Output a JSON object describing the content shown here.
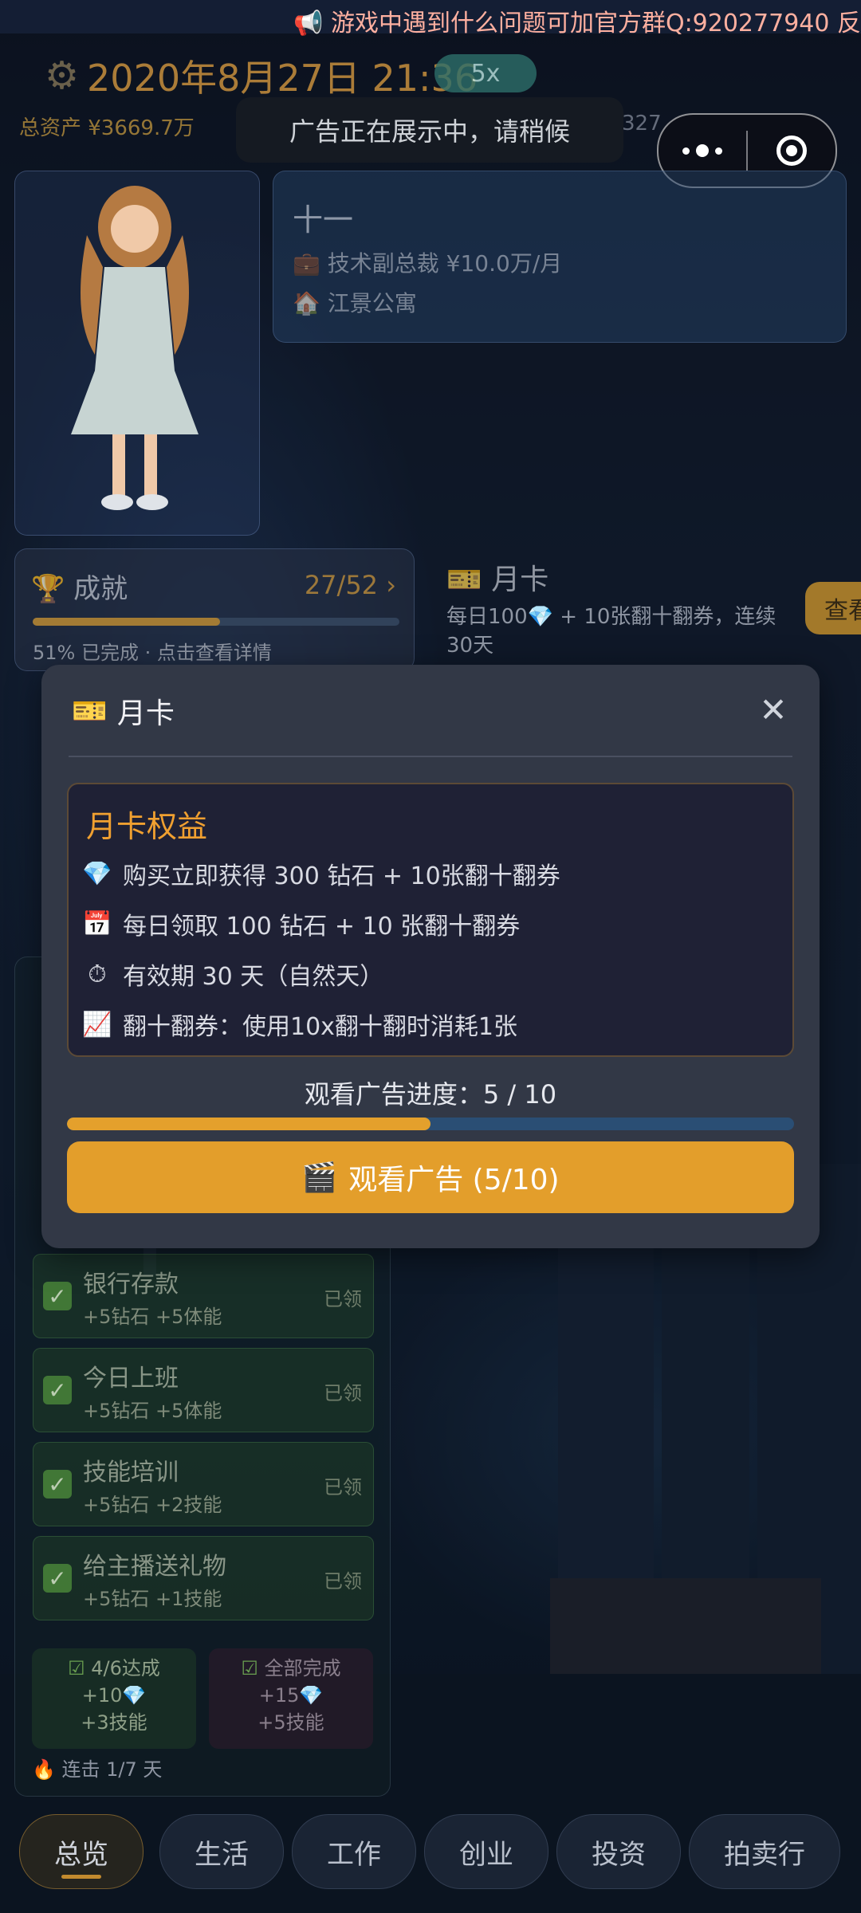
{
  "marquee": {
    "text": "📢 游戏中遇到什么问题可加官方群Q:920277940 反"
  },
  "header": {
    "datetime": "2020年8月27日 21:36",
    "speed": "5x",
    "assets": "总资产 ¥3669.7万",
    "assets_right_partial": "327"
  },
  "toast": "广告正在展示中，请稍候",
  "profile": {
    "name": "十一",
    "job": "技术副总裁 ¥10.0万/月",
    "home": "江景公寓"
  },
  "achievement": {
    "title": "成就",
    "count": "27/52",
    "progress": 0.51,
    "subtitle": "51% 已完成 · 点击查看详情"
  },
  "month_card_tile": {
    "title": "月卡",
    "desc": "每日100💎 + 10张翻十翻券，连续30天",
    "view_label": "查看"
  },
  "tasks": [
    {
      "name": "银行存款",
      "reward": "+5钻石 +5体能",
      "state": "已领"
    },
    {
      "name": "今日上班",
      "reward": "+5钻石 +5体能",
      "state": "已领"
    },
    {
      "name": "技能培训",
      "reward": "+5钻石 +2技能",
      "state": "已领"
    },
    {
      "name": "给主播送礼物",
      "reward": "+5钻石 +1技能",
      "state": "已领"
    }
  ],
  "task_summary": {
    "left": {
      "title": "4/6达成",
      "line1": "+10💎",
      "line2": "+3技能"
    },
    "right": {
      "title": "全部完成",
      "line1": "+15💎",
      "line2": "+5技能"
    },
    "streak": "连击 1/7 天"
  },
  "nav": [
    "总览",
    "生活",
    "工作",
    "创业",
    "投资",
    "拍卖行"
  ],
  "modal": {
    "title": "月卡",
    "close": "✕",
    "benefits_title": "月卡权益",
    "benefits": [
      {
        "icon": "💎",
        "text": "购买立即获得 300 钻石 + 10张翻十翻券"
      },
      {
        "icon": "📅",
        "text": "每日领取 100 钻石 + 10 张翻十翻券"
      },
      {
        "icon": "⏱",
        "text": "有效期 30 天（自然天）"
      },
      {
        "icon": "📈",
        "text": "翻十翻券：使用10x翻十翻时消耗1张"
      }
    ],
    "progress_label": "观看广告进度：5 / 10",
    "progress": 0.5,
    "watch_button": "观看广告 (5/10)",
    "watch_icon": "🎬"
  },
  "colors": {
    "accent": "#e39e2b",
    "modal_bg": "#323846",
    "benefits_title": "#f0a030",
    "progress_track": "#2a4e74"
  }
}
